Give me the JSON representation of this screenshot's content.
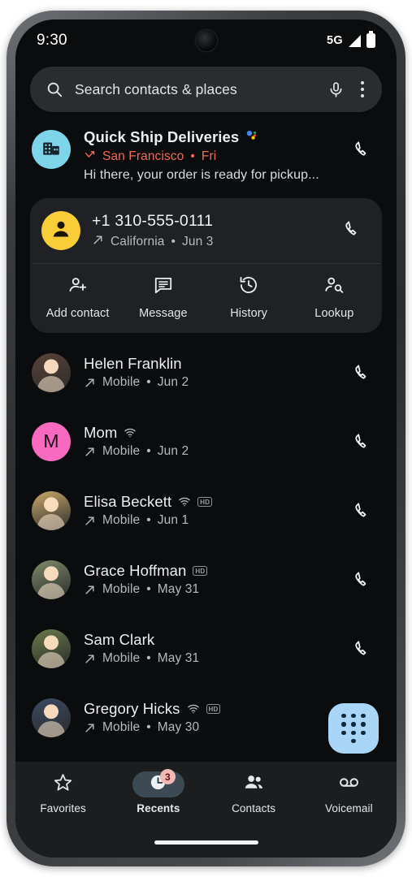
{
  "status_bar": {
    "time": "9:30",
    "network": "5G",
    "signal_icon": "signal-bars-icon",
    "battery_icon": "battery-full-icon"
  },
  "search": {
    "placeholder": "Search contacts & places",
    "search_icon": "search-icon",
    "mic_icon": "microphone-icon",
    "overflow_icon": "more-options-icon"
  },
  "featured": {
    "name": "Quick Ship Deliveries",
    "verified_icon": "google-assistant-dots-icon",
    "call_type_icon": "missed-call-icon",
    "location": "San Francisco",
    "separator": "•",
    "date": "Fri",
    "snippet": "Hi there, your order is ready for pickup...",
    "call_icon": "call-icon",
    "avatar_icon": "business-building-icon",
    "avatar_color": "#7ed4e8",
    "accent_color": "#ef6a5a"
  },
  "expanded": {
    "number": "+1 310-555-0111",
    "call_type_icon": "outgoing-call-icon",
    "location": "California",
    "separator": "•",
    "date": "Jun 3",
    "call_icon": "call-icon",
    "avatar_icon": "person-icon",
    "avatar_color": "#f9cd38",
    "actions": [
      {
        "label": "Add contact",
        "icon": "person-add-icon"
      },
      {
        "label": "Message",
        "icon": "message-icon"
      },
      {
        "label": "History",
        "icon": "history-icon"
      },
      {
        "label": "Lookup",
        "icon": "person-search-icon"
      }
    ]
  },
  "calls": [
    {
      "name": "Helen Franklin",
      "call_type_icon": "outgoing-call-icon",
      "line": "Mobile",
      "separator": "•",
      "date": "Jun 2",
      "wifi": false,
      "hd": false,
      "hd_label": "HD",
      "avatar_color": "#5a4338",
      "call_icon": "call-icon"
    },
    {
      "name": "Mom",
      "call_type_icon": "outgoing-call-icon",
      "line": "Mobile",
      "separator": "•",
      "date": "Jun 2",
      "wifi": true,
      "hd": false,
      "hd_label": "HD",
      "avatar_initial": "M",
      "avatar_color": "#f86ac0",
      "call_icon": "call-icon"
    },
    {
      "name": "Elisa Beckett",
      "call_type_icon": "outgoing-call-icon",
      "line": "Mobile",
      "separator": "•",
      "date": "Jun 1",
      "wifi": true,
      "hd": true,
      "hd_label": "HD",
      "avatar_color": "#c9a96a",
      "call_icon": "call-icon"
    },
    {
      "name": "Grace Hoffman",
      "call_type_icon": "outgoing-call-icon",
      "line": "Mobile",
      "separator": "•",
      "date": "May 31",
      "wifi": false,
      "hd": true,
      "hd_label": "HD",
      "avatar_color": "#7e8c6a",
      "call_icon": "call-icon"
    },
    {
      "name": "Sam Clark",
      "call_type_icon": "outgoing-call-icon",
      "line": "Mobile",
      "separator": "•",
      "date": "May 31",
      "wifi": false,
      "hd": false,
      "hd_label": "HD",
      "avatar_color": "#6b7a4a",
      "call_icon": "call-icon"
    },
    {
      "name": "Gregory Hicks",
      "call_type_icon": "outgoing-call-icon",
      "line": "Mobile",
      "separator": "•",
      "date": "May 30",
      "wifi": true,
      "hd": true,
      "hd_label": "HD",
      "avatar_color": "#3c4a63",
      "call_icon": "call-icon"
    }
  ],
  "fab": {
    "icon": "dialpad-icon",
    "color": "#a9d5f6"
  },
  "bottom_nav": {
    "items": [
      {
        "label": "Favorites",
        "icon": "star-icon",
        "active": false,
        "badge": ""
      },
      {
        "label": "Recents",
        "icon": "recents-clock-icon",
        "active": true,
        "badge": "3"
      },
      {
        "label": "Contacts",
        "icon": "contacts-people-icon",
        "active": false,
        "badge": ""
      },
      {
        "label": "Voicemail",
        "icon": "voicemail-icon",
        "active": false,
        "badge": ""
      }
    ],
    "badge_color": "#f2b8b5"
  }
}
